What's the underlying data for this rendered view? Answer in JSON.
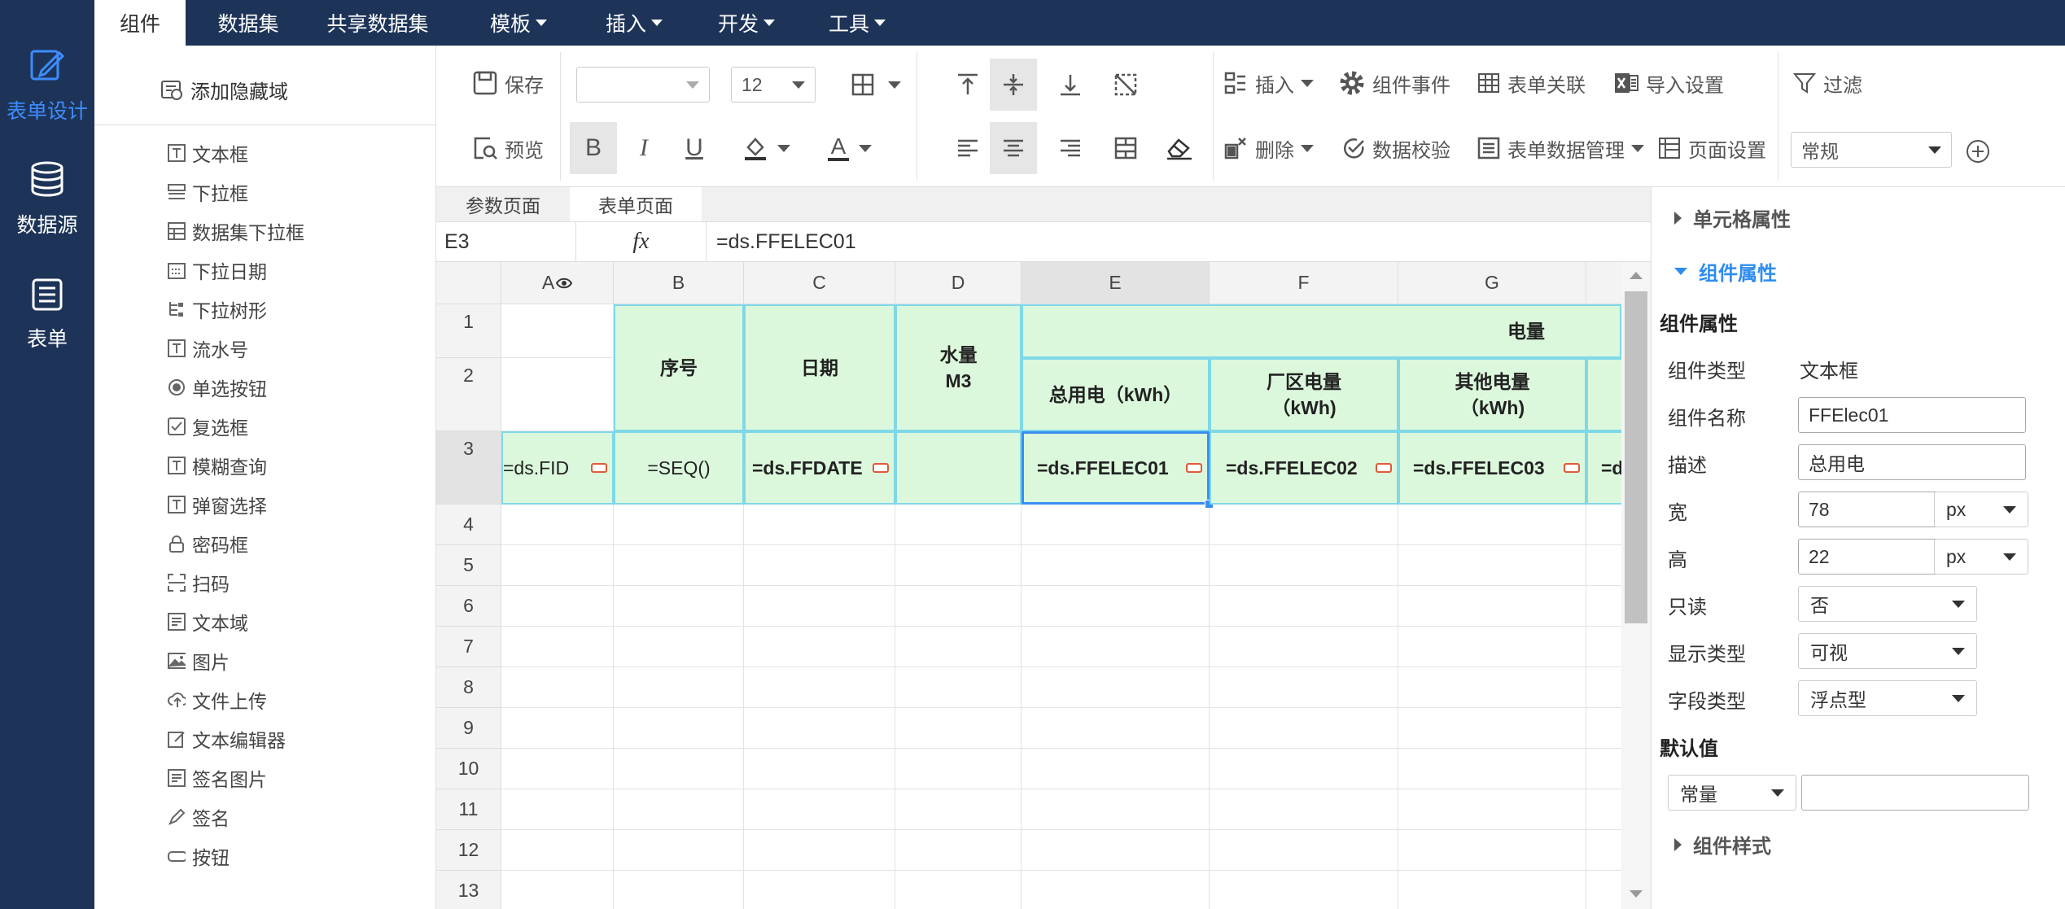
{
  "leftnav": {
    "items": [
      {
        "label": "表单设计",
        "icon": "form-design-icon"
      },
      {
        "label": "数据源",
        "icon": "database-icon"
      },
      {
        "label": "表单",
        "icon": "form-icon"
      }
    ]
  },
  "topnav": {
    "tabs": [
      "组件",
      "数据集",
      "共享数据集",
      "模板",
      "插入",
      "开发",
      "工具"
    ]
  },
  "components": {
    "add_hidden_area": "添加隐藏域",
    "items": [
      "文本框",
      "下拉框",
      "数据集下拉框",
      "下拉日期",
      "下拉树形",
      "流水号",
      "单选按钮",
      "复选框",
      "模糊查询",
      "弹窗选择",
      "密码框",
      "扫码",
      "文本域",
      "图片",
      "文件上传",
      "文本编辑器",
      "签名图片",
      "签名",
      "按钮"
    ]
  },
  "toolbar": {
    "save": "保存",
    "preview": "预览",
    "font_size": "12",
    "insert": "插入",
    "delete": "删除",
    "component_event": "组件事件",
    "data_validate": "数据校验",
    "form_relation": "表单关联",
    "form_data_manage": "表单数据管理",
    "import_settings": "导入设置",
    "page_settings": "页面设置",
    "filter": "过滤",
    "format": "常规",
    "bold": "B",
    "italic": "I",
    "underline": "U",
    "font_color_glyph": "A"
  },
  "sheet_tabs": [
    "参数页面",
    "表单页面"
  ],
  "formula_bar": {
    "cell_ref": "E3",
    "fx": "fx",
    "formula": "=ds.FFELEC01"
  },
  "grid": {
    "columns": [
      "A",
      "B",
      "C",
      "D",
      "E",
      "F",
      "G"
    ],
    "rows": [
      "1",
      "2",
      "3",
      "4",
      "5",
      "6",
      "7",
      "8",
      "9",
      "10",
      "11",
      "12",
      "13"
    ],
    "cells": {
      "b_header": "序号",
      "c_header": "日期",
      "d_header": "水量\nM3",
      "e_group": "电量",
      "e_header": "总用电（kWh）",
      "f_header": "厂区电量\n（kWh)",
      "g_header": "其他电量\n（kWh)",
      "a3": "=ds.FID",
      "b3": "=SEQ()",
      "c3": "=ds.FFDATE",
      "e3": "=ds.FFELEC01",
      "f3": "=ds.FFELEC02",
      "g3": "=ds.FFELEC03",
      "h3": "=d"
    }
  },
  "props": {
    "cell_props": "单元格属性",
    "comp_props": "组件属性",
    "comp_props_title": "组件属性",
    "type_label": "组件类型",
    "type_value": "文本框",
    "name_label": "组件名称",
    "name_value": "FFElec01",
    "desc_label": "描述",
    "desc_value": "总用电",
    "width_label": "宽",
    "width_value": "78",
    "width_unit": "px",
    "height_label": "高",
    "height_value": "22",
    "height_unit": "px",
    "readonly_label": "只读",
    "readonly_value": "否",
    "display_label": "显示类型",
    "display_value": "可视",
    "field_label": "字段类型",
    "field_value": "浮点型",
    "default_title": "默认值",
    "default_type": "常量",
    "default_value": "",
    "comp_style": "组件样式"
  },
  "colors": {
    "nav_bg": "#1d3458",
    "accent": "#2d8cf0",
    "cell_green": "#dcf8dc",
    "cell_border": "#7fd8e8"
  }
}
